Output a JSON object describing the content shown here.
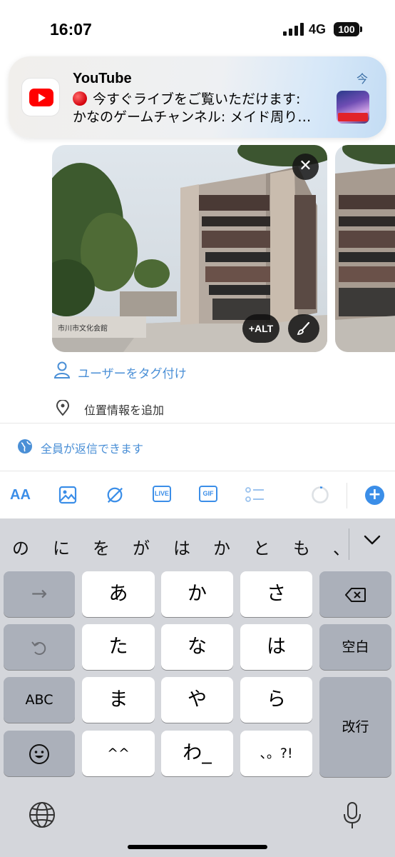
{
  "status_bar": {
    "time": "16:07",
    "network": "4G",
    "battery": "100"
  },
  "notification": {
    "app": "YouTube",
    "line1": "今すぐライブをご覧いただけます:",
    "line2": "かなのゲームチャンネル: メイド周り…",
    "time": "今",
    "icon": "youtube-icon"
  },
  "media": {
    "photo1_sign": "市川市文化会館",
    "alt_label": "+ALT"
  },
  "options": {
    "tag_users": "ユーザーをタグ付け",
    "add_location": "位置情報を追加",
    "reply_setting": "全員が返信できます"
  },
  "toolbar": {
    "text_style": "AA",
    "live_badge": "LIVE",
    "gif_badge": "GIF",
    "add": "+"
  },
  "keyboard": {
    "candidates": [
      "の",
      "に",
      "を",
      "が",
      "は",
      "か",
      "と",
      "も",
      "、"
    ],
    "rows": {
      "r1": [
        "→",
        "あ",
        "か",
        "さ",
        "⌫"
      ],
      "r2": [
        "↺",
        "た",
        "な",
        "は",
        "空白"
      ],
      "r3": [
        "ABC",
        "ま",
        "や",
        "ら",
        "改行"
      ],
      "r4": [
        "☺",
        "^^",
        "わ_",
        "、。?!"
      ]
    }
  },
  "colors": {
    "accent": "#3b8ee8",
    "link": "#4a8fd6",
    "keyboard_bg": "#d4d6db"
  }
}
